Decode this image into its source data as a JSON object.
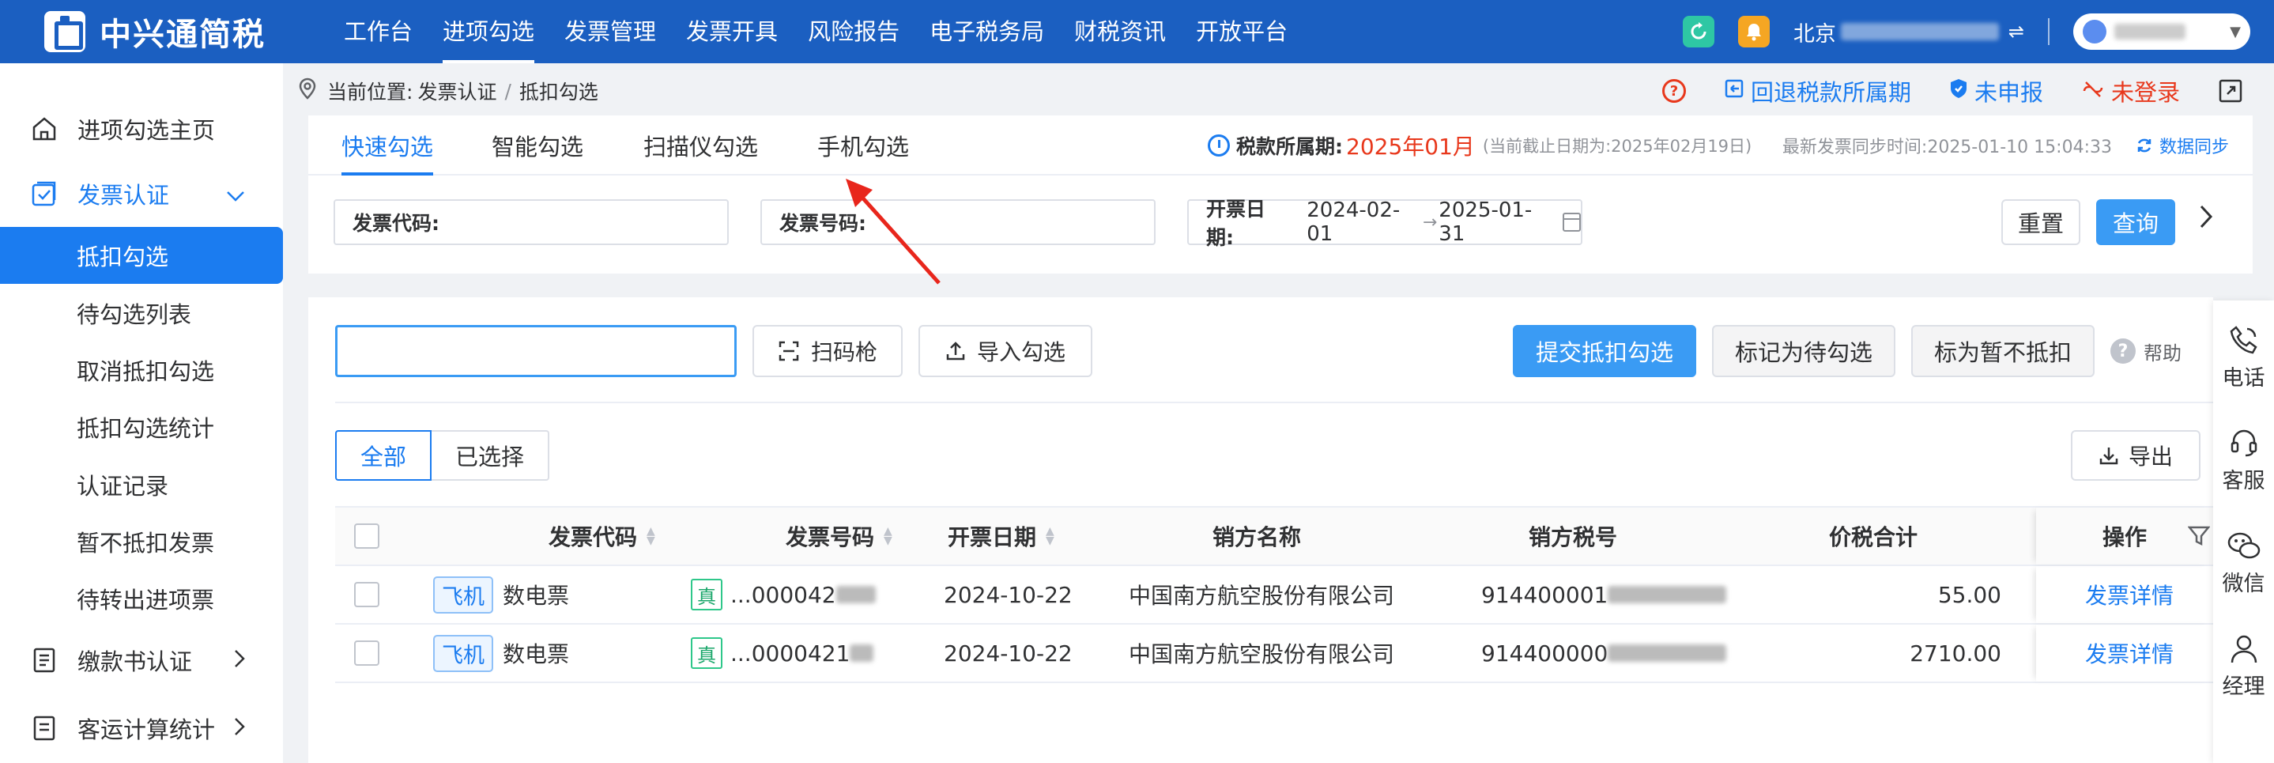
{
  "app": {
    "name": "中兴通简税"
  },
  "topnav": [
    "工作台",
    "进项勾选",
    "发票管理",
    "发票开具",
    "风险报告",
    "电子税务局",
    "财税资讯",
    "开放平台"
  ],
  "topnav_active": 1,
  "company": {
    "prefix": "北京"
  },
  "sidebar": {
    "items": [
      {
        "label": "进项勾选主页"
      },
      {
        "label": "发票认证"
      },
      {
        "label": "缴款书认证"
      },
      {
        "label": "客运计算统计"
      }
    ],
    "sub": [
      "抵扣勾选",
      "待勾选列表",
      "取消抵扣勾选",
      "抵扣勾选统计",
      "认证记录",
      "暂不抵扣发票",
      "待转出进项票"
    ]
  },
  "breadcrumb": {
    "prefix": "当前位置:",
    "path": [
      "发票认证",
      "抵扣勾选"
    ],
    "sep": "/"
  },
  "header_actions": {
    "rollback": "回退税款所属期",
    "declare": "未申报",
    "login": "未登录"
  },
  "tabs": [
    "快速勾选",
    "智能勾选",
    "扫描仪勾选",
    "手机勾选"
  ],
  "period": {
    "label": "税款所属期:",
    "value": "2025年01月",
    "note": "(当前截止日期为:2025年02月19日)"
  },
  "sync": {
    "text": "最新发票同步时间:2025-01-10 15:04:33",
    "link": "数据同步"
  },
  "filters": {
    "code_label": "发票代码:",
    "number_label": "发票号码:",
    "date_label": "开票日期:",
    "date_start": "2024-02-01",
    "date_end": "2025-01-31",
    "reset": "重置",
    "query": "查询"
  },
  "toolbar": {
    "scanner": "扫码枪",
    "import": "导入勾选",
    "submit": "提交抵扣勾选",
    "mark_pending": "标记为待勾选",
    "mark_no_deduct": "标为暂不抵扣",
    "help": "帮助",
    "export": "导出"
  },
  "segments": [
    "全部",
    "已选择"
  ],
  "table": {
    "headers": [
      "发票代码",
      "发票号码",
      "开票日期",
      "销方名称",
      "销方税号",
      "价税合计",
      "操作"
    ],
    "rows": [
      {
        "tag": "飞机",
        "type": "数电票",
        "zhen": "真",
        "number": "...000042",
        "date": "2024-10-22",
        "seller": "中国南方航空股份有限公司",
        "tax_id": "914400001",
        "amount": "55.00",
        "action": "发票详情"
      },
      {
        "tag": "飞机",
        "type": "数电票",
        "zhen": "真",
        "number": "...0000421",
        "date": "2024-10-22",
        "seller": "中国南方航空股份有限公司",
        "tax_id": "914400000",
        "amount": "2710.00",
        "action": "发票详情"
      }
    ]
  },
  "float_bar": [
    "电话",
    "客服",
    "微信",
    "经理"
  ],
  "colors": {
    "brand": "#1b5fc1",
    "primary": "#1b7cf0",
    "button": "#3a9bf4",
    "danger": "#e8381c"
  }
}
